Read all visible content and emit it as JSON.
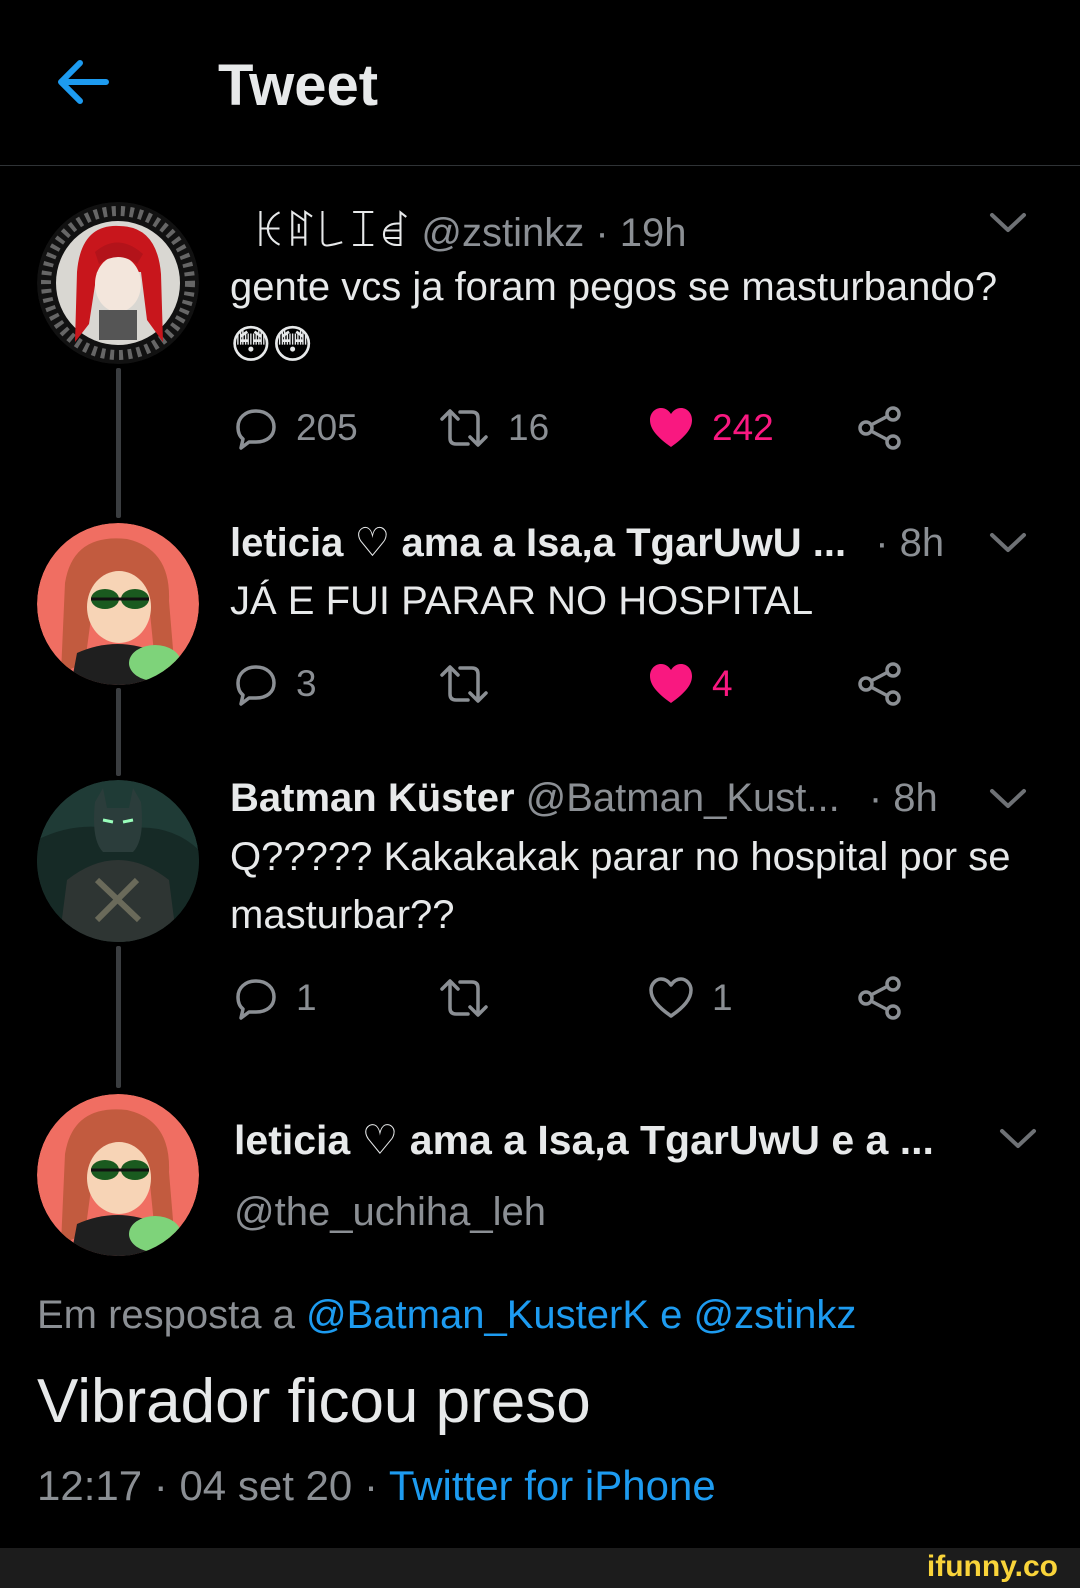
{
  "header": {
    "title": "Tweet"
  },
  "tweets": [
    {
      "name": "ꀘꍏ꒒ꀤꀸ",
      "handle": "@zstinkz",
      "time": "· 19h",
      "text": "gente vcs ja foram pegos se masturbando? 😳😳",
      "replies": "205",
      "retweets": "16",
      "likes": "242"
    },
    {
      "name": "leticia ♡ ama a Isa,a TgarUwU ...",
      "time": "· 8h",
      "text": "JÁ E FUI PARAR NO HOSPITAL",
      "replies": "3",
      "likes": "4"
    },
    {
      "name": "Batman Küster",
      "handle": "@Batman_Kust...",
      "time": "· 8h",
      "text": "Q????? Kakakakak parar no hospital por se masturbar??",
      "replies": "1",
      "likes": "1"
    }
  ],
  "focus": {
    "name": "leticia ♡ ama a Isa,a TgarUwU e a ...",
    "handle": "@the_uchiha_leh",
    "reply_prefix": "Em resposta a",
    "reply_user1": "@Batman_KusterK",
    "reply_and": "e",
    "reply_user2": "@zstinkz",
    "text": "Vibrador ficou preso",
    "time": "12:17",
    "date": "04 set 20",
    "separator": "·",
    "source": "Twitter for iPhone"
  },
  "watermark": "ifunny.co",
  "colors": {
    "accent": "#1d9bf0",
    "like": "#f91880",
    "muted": "#8b8f94"
  }
}
